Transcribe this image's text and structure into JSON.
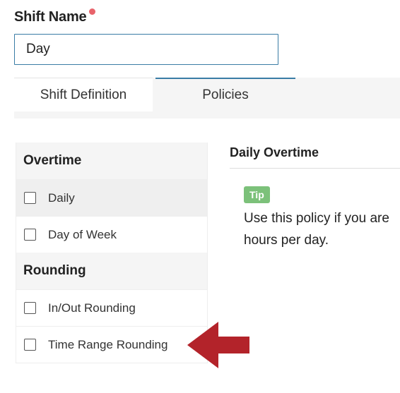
{
  "form": {
    "shift_name_label": "Shift Name",
    "shift_name_value": "Day"
  },
  "tabs": [
    {
      "label": "Shift Definition"
    },
    {
      "label": "Policies"
    }
  ],
  "policies": {
    "sections": [
      {
        "label": "Overtime",
        "items": [
          {
            "label": "Daily",
            "checked": false
          },
          {
            "label": "Day of Week",
            "checked": false
          }
        ]
      },
      {
        "label": "Rounding",
        "items": [
          {
            "label": "In/Out Rounding",
            "checked": false
          },
          {
            "label": "Time Range Rounding",
            "checked": false
          }
        ]
      }
    ]
  },
  "detail": {
    "title": "Daily Overtime",
    "tip_badge": "Tip",
    "tip_text": "Use this policy if you are hours per day."
  },
  "colors": {
    "required_dot": "#e8636b",
    "accent": "#3a7ca5",
    "tip_badge": "#7cc17a",
    "arrow": "#b3232a"
  },
  "icons": {
    "arrow": "left-pointing-arrow"
  }
}
